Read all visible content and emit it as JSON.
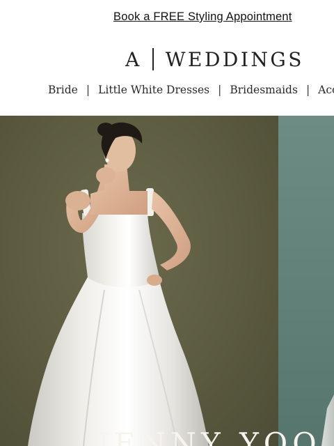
{
  "promo": {
    "label": "Book a FREE Styling Appointment"
  },
  "brand": {
    "letter": "A",
    "word": "WEDDINGS"
  },
  "nav": {
    "items": [
      {
        "label": "Bride"
      },
      {
        "label": "Little White Dresses"
      },
      {
        "label": "Bridesmaids"
      },
      {
        "label": "Acces"
      }
    ],
    "separator": "|"
  },
  "hero": {
    "title": "JENNY YOO",
    "image": "bride-in-white-square-neck-gown-photo",
    "colors": {
      "left_backdrop": "#5c5b40",
      "right_backdrop": "#6c8c84",
      "gown": "#f1efea",
      "title": "#f7f4ef"
    }
  }
}
